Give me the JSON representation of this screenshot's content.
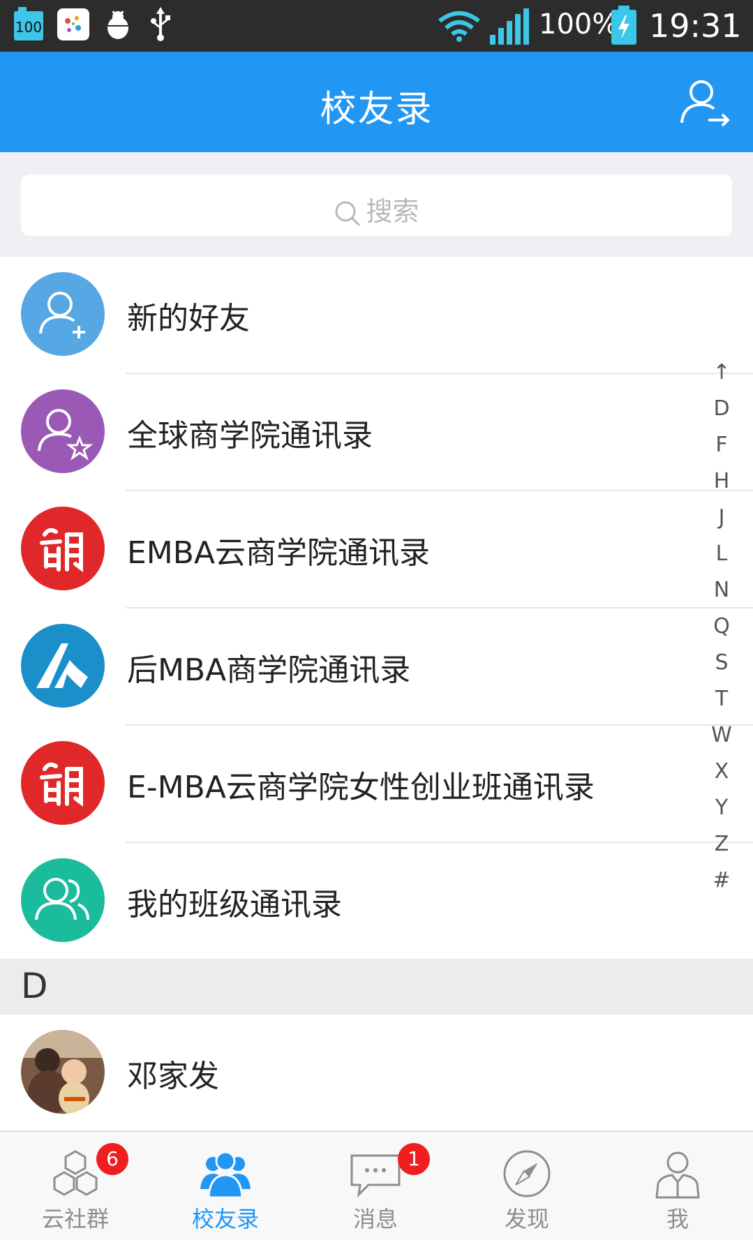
{
  "status_bar": {
    "notif_badge": "100",
    "battery_percent": "100%",
    "time": "19:31",
    "icons": [
      "battery-100-icon",
      "photos-app-icon",
      "debug-bug-icon",
      "usb-icon",
      "wifi-icon",
      "signal-icon",
      "charging-battery-icon"
    ]
  },
  "header": {
    "title": "校友录",
    "action_icon": "user-export-icon",
    "bg_color": "#2196f3"
  },
  "search": {
    "placeholder": "搜索"
  },
  "groups": [
    {
      "label": "新的好友",
      "icon": "new-friend-icon",
      "color": "#56a7e3"
    },
    {
      "label": "全球商学院通讯录",
      "icon": "starred-contacts-icon",
      "color": "#9b59b6"
    },
    {
      "label": "EMBA云商学院通讯录",
      "icon": "lang-logo-icon",
      "color": "#e0282a"
    },
    {
      "label": "后MBA商学院通讯录",
      "icon": "houmba-logo-icon",
      "color": "#1a8fc9"
    },
    {
      "label": "E-MBA云商学院女性创业班通讯录",
      "icon": "lang-logo-icon",
      "color": "#e0282a"
    },
    {
      "label": "我的班级通讯录",
      "icon": "class-contacts-icon",
      "color": "#1abc9c"
    }
  ],
  "section": {
    "letter": "D"
  },
  "contacts": [
    {
      "name": "邓家发"
    }
  ],
  "index_letters": [
    "↑",
    "D",
    "F",
    "H",
    "J",
    "L",
    "N",
    "Q",
    "S",
    "T",
    "W",
    "X",
    "Y",
    "Z",
    "#"
  ],
  "nav": [
    {
      "label": "云社群",
      "icon": "cloud-community-icon",
      "badge": "6"
    },
    {
      "label": "校友录",
      "icon": "alumni-icon",
      "active": true
    },
    {
      "label": "消息",
      "icon": "message-icon",
      "badge": "1"
    },
    {
      "label": "发现",
      "icon": "compass-icon"
    },
    {
      "label": "我",
      "icon": "me-icon"
    }
  ]
}
